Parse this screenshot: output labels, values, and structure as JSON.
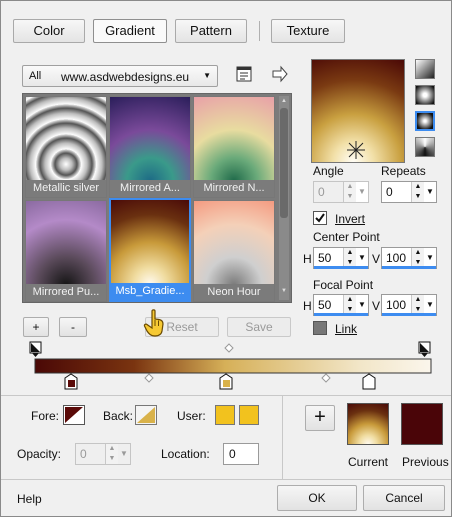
{
  "tabs": [
    {
      "label": "Color"
    },
    {
      "label": "Gradient"
    },
    {
      "label": "Pattern"
    },
    {
      "label": "Texture"
    }
  ],
  "library": {
    "filter_value": "All",
    "filter_source": "www.asdwebdesigns.eu"
  },
  "gradients": [
    {
      "label": "Metallic silver"
    },
    {
      "label": "Mirrored A..."
    },
    {
      "label": "Mirrored N..."
    },
    {
      "label": "Mirrored Pu..."
    },
    {
      "label": "Msb_Gradie..."
    },
    {
      "label": "Neon Hour"
    }
  ],
  "actions": {
    "add": "+",
    "remove": "-",
    "reset": "Reset",
    "save": "Save"
  },
  "settings": {
    "angle_label": "Angle",
    "angle_value": "0",
    "repeats_label": "Repeats",
    "repeats_value": "0",
    "invert_label": "Invert",
    "invert_checked": true,
    "center_point_label": "Center Point",
    "center_h_label": "H",
    "center_h_value": "50",
    "center_v_label": "V",
    "center_v_value": "100",
    "focal_point_label": "Focal Point",
    "focal_h_label": "H",
    "focal_h_value": "50",
    "focal_v_label": "V",
    "focal_v_value": "100",
    "link_label": "Link"
  },
  "stops": {
    "fore_label": "Fore:",
    "back_label": "Back:",
    "user_label": "User:",
    "opacity_label": "Opacity:",
    "opacity_value": "0",
    "location_label": "Location:",
    "location_value": "0"
  },
  "preview": {
    "add_label": "+",
    "current_label": "Current",
    "previous_label": "Previous"
  },
  "footer": {
    "help": "Help",
    "ok": "OK",
    "cancel": "Cancel"
  },
  "colors": {
    "dark_red": "#5a0a08",
    "gold": "#d9b24a",
    "cream": "#f7f0de",
    "user_yellow": "#f2c21e",
    "selection_blue": "#3d8cf0"
  }
}
